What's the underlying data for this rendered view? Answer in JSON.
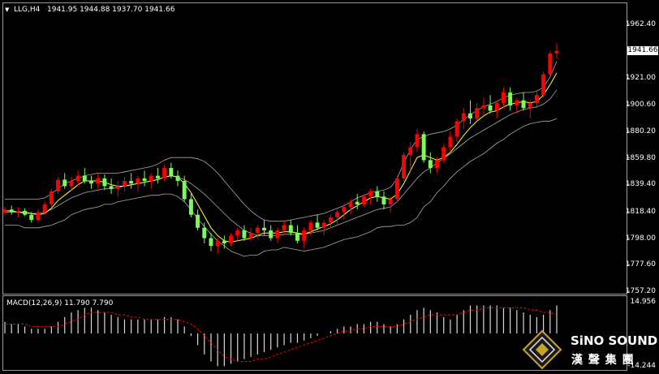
{
  "chart_header": {
    "dropdown_glyph": "▼",
    "symbol_tf": "LLG,H4",
    "ohlc": "1941.95 1944.88 1937.70 1941.66"
  },
  "price_axis": {
    "ticks": [
      "1962.40",
      "1941.66",
      "1921.00",
      "1900.60",
      "1880.20",
      "1859.80",
      "1839.40",
      "1818.40",
      "1798.00",
      "1777.60",
      "1757.20"
    ],
    "current_price": "1941.66"
  },
  "macd_panel": {
    "label": "MACD(12,26,9) 11.790 7.790",
    "max_label": "14.956",
    "min_label": "-14.244"
  },
  "watermark": {
    "brand_en": "SiNO SOUND",
    "brand_cn": "漢 聲 集 團",
    "logo_icon": "diamond-emblem-icon"
  },
  "colors": {
    "background": "#000000",
    "bull_candle": "#ff0000",
    "bear_candle": "#7cfc5a",
    "bollinger": "#a9a9a9",
    "moving_average": "#ffff33",
    "macd_histogram": "#d9d9d9",
    "macd_signal": "#ff0000",
    "text": "#ffffff"
  },
  "chart_data": {
    "type": "candlestick",
    "symbol": "LLG",
    "timeframe": "H4",
    "ylim": [
      1757.2,
      1965
    ],
    "candles": [
      [
        1818,
        1822,
        1815,
        1820
      ],
      [
        1820,
        1823,
        1816,
        1818
      ],
      [
        1818,
        1822,
        1814,
        1819
      ],
      [
        1819,
        1821,
        1815,
        1816
      ],
      [
        1816,
        1818,
        1810,
        1812
      ],
      [
        1812,
        1820,
        1810,
        1818
      ],
      [
        1818,
        1826,
        1816,
        1824
      ],
      [
        1824,
        1836,
        1822,
        1834
      ],
      [
        1834,
        1845,
        1832,
        1843
      ],
      [
        1843,
        1848,
        1836,
        1838
      ],
      [
        1838,
        1845,
        1834,
        1842
      ],
      [
        1842,
        1850,
        1838,
        1846
      ],
      [
        1846,
        1852,
        1840,
        1842
      ],
      [
        1842,
        1846,
        1836,
        1840
      ],
      [
        1840,
        1848,
        1836,
        1844
      ],
      [
        1844,
        1847,
        1835,
        1838
      ],
      [
        1838,
        1844,
        1832,
        1836
      ],
      [
        1836,
        1842,
        1830,
        1838
      ],
      [
        1838,
        1845,
        1834,
        1842
      ],
      [
        1842,
        1848,
        1836,
        1840
      ],
      [
        1840,
        1846,
        1834,
        1844
      ],
      [
        1844,
        1850,
        1838,
        1842
      ],
      [
        1842,
        1848,
        1836,
        1846
      ],
      [
        1846,
        1852,
        1840,
        1844
      ],
      [
        1844,
        1854,
        1842,
        1852
      ],
      [
        1852,
        1856,
        1844,
        1846
      ],
      [
        1846,
        1850,
        1838,
        1842
      ],
      [
        1842,
        1846,
        1826,
        1828
      ],
      [
        1828,
        1832,
        1814,
        1816
      ],
      [
        1816,
        1820,
        1804,
        1806
      ],
      [
        1806,
        1810,
        1794,
        1798
      ],
      [
        1798,
        1802,
        1788,
        1792
      ],
      [
        1792,
        1798,
        1786,
        1796
      ],
      [
        1796,
        1800,
        1790,
        1794
      ],
      [
        1794,
        1802,
        1792,
        1800
      ],
      [
        1800,
        1806,
        1796,
        1804
      ],
      [
        1804,
        1808,
        1796,
        1798
      ],
      [
        1798,
        1806,
        1796,
        1802
      ],
      [
        1802,
        1808,
        1798,
        1806
      ],
      [
        1806,
        1812,
        1800,
        1804
      ],
      [
        1804,
        1808,
        1796,
        1798
      ],
      [
        1798,
        1806,
        1794,
        1804
      ],
      [
        1804,
        1812,
        1800,
        1808
      ],
      [
        1808,
        1812,
        1800,
        1802
      ],
      [
        1802,
        1808,
        1794,
        1796
      ],
      [
        1796,
        1806,
        1790,
        1804
      ],
      [
        1804,
        1812,
        1800,
        1810
      ],
      [
        1810,
        1816,
        1804,
        1806
      ],
      [
        1806,
        1812,
        1800,
        1810
      ],
      [
        1810,
        1816,
        1806,
        1814
      ],
      [
        1814,
        1820,
        1808,
        1818
      ],
      [
        1818,
        1824,
        1812,
        1822
      ],
      [
        1822,
        1828,
        1816,
        1826
      ],
      [
        1826,
        1832,
        1820,
        1824
      ],
      [
        1824,
        1832,
        1822,
        1830
      ],
      [
        1830,
        1836,
        1824,
        1834
      ],
      [
        1834,
        1838,
        1826,
        1830
      ],
      [
        1830,
        1834,
        1820,
        1824
      ],
      [
        1824,
        1830,
        1818,
        1828
      ],
      [
        1828,
        1846,
        1826,
        1844
      ],
      [
        1844,
        1864,
        1842,
        1862
      ],
      [
        1862,
        1872,
        1850,
        1868
      ],
      [
        1868,
        1882,
        1864,
        1878
      ],
      [
        1878,
        1880,
        1856,
        1858
      ],
      [
        1858,
        1864,
        1848,
        1852
      ],
      [
        1852,
        1860,
        1848,
        1858
      ],
      [
        1858,
        1870,
        1856,
        1868
      ],
      [
        1868,
        1880,
        1864,
        1876
      ],
      [
        1876,
        1890,
        1872,
        1888
      ],
      [
        1888,
        1898,
        1882,
        1894
      ],
      [
        1894,
        1904,
        1886,
        1890
      ],
      [
        1890,
        1902,
        1888,
        1898
      ],
      [
        1898,
        1906,
        1892,
        1900
      ],
      [
        1900,
        1908,
        1894,
        1896
      ],
      [
        1896,
        1904,
        1890,
        1902
      ],
      [
        1902,
        1914,
        1898,
        1910
      ],
      [
        1910,
        1914,
        1896,
        1900
      ],
      [
        1900,
        1906,
        1894,
        1904
      ],
      [
        1904,
        1910,
        1896,
        1898
      ],
      [
        1898,
        1904,
        1890,
        1902
      ],
      [
        1902,
        1912,
        1898,
        1908
      ],
      [
        1908,
        1926,
        1906,
        1924
      ],
      [
        1924,
        1942,
        1922,
        1940
      ],
      [
        1940,
        1948,
        1936,
        1942
      ]
    ],
    "series": [
      {
        "name": "Bollinger Upper",
        "values": [
          1828,
          1828,
          1828,
          1828,
          1828,
          1828,
          1829,
          1832,
          1836,
          1840,
          1842,
          1844,
          1846,
          1847,
          1848,
          1848,
          1848,
          1848,
          1849,
          1850,
          1851,
          1852,
          1853,
          1855,
          1858,
          1860,
          1860,
          1860,
          1860,
          1859,
          1857,
          1853,
          1848,
          1842,
          1836,
          1830,
          1824,
          1819,
          1815,
          1812,
          1811,
          1811,
          1811,
          1812,
          1813,
          1814,
          1815,
          1816,
          1817,
          1819,
          1821,
          1823,
          1826,
          1829,
          1831,
          1833,
          1834,
          1835,
          1837,
          1844,
          1856,
          1866,
          1874,
          1876,
          1878,
          1879,
          1880,
          1882,
          1885,
          1889,
          1893,
          1896,
          1899,
          1901,
          1903,
          1906,
          1908,
          1909,
          1910,
          1910,
          1911,
          1914,
          1922,
          1934
        ]
      },
      {
        "name": "Bollinger Middle",
        "values": [
          1818,
          1818,
          1818,
          1817,
          1817,
          1817,
          1818,
          1820,
          1823,
          1826,
          1829,
          1831,
          1833,
          1834,
          1835,
          1836,
          1836,
          1837,
          1838,
          1839,
          1840,
          1841,
          1842,
          1843,
          1845,
          1846,
          1845,
          1843,
          1840,
          1836,
          1832,
          1827,
          1822,
          1817,
          1812,
          1808,
          1804,
          1802,
          1800,
          1800,
          1800,
          1800,
          1801,
          1801,
          1801,
          1801,
          1802,
          1803,
          1804,
          1806,
          1808,
          1810,
          1812,
          1814,
          1816,
          1818,
          1820,
          1821,
          1822,
          1826,
          1832,
          1838,
          1844,
          1849,
          1852,
          1856,
          1859,
          1863,
          1867,
          1871,
          1875,
          1878,
          1881,
          1884,
          1887,
          1890,
          1893,
          1895,
          1897,
          1898,
          1899,
          1901,
          1905,
          1912
        ]
      },
      {
        "name": "Bollinger Lower",
        "values": [
          1808,
          1808,
          1808,
          1806,
          1806,
          1806,
          1807,
          1808,
          1810,
          1812,
          1816,
          1818,
          1820,
          1821,
          1822,
          1824,
          1824,
          1826,
          1827,
          1828,
          1829,
          1830,
          1831,
          1831,
          1832,
          1832,
          1830,
          1826,
          1820,
          1813,
          1807,
          1801,
          1796,
          1792,
          1788,
          1786,
          1784,
          1785,
          1785,
          1788,
          1789,
          1789,
          1791,
          1790,
          1789,
          1788,
          1789,
          1790,
          1791,
          1793,
          1795,
          1797,
          1798,
          1799,
          1801,
          1803,
          1806,
          1807,
          1807,
          1808,
          1808,
          1810,
          1814,
          1822,
          1826,
          1833,
          1838,
          1844,
          1849,
          1853,
          1857,
          1860,
          1863,
          1867,
          1871,
          1874,
          1878,
          1881,
          1884,
          1886,
          1887,
          1888,
          1888,
          1890
        ]
      },
      {
        "name": "Moving Average",
        "values": [
          1819,
          1819,
          1818,
          1818,
          1817,
          1816,
          1817,
          1821,
          1827,
          1831,
          1835,
          1839,
          1842,
          1842,
          1842,
          1841,
          1839,
          1838,
          1838,
          1839,
          1840,
          1841,
          1842,
          1843,
          1845,
          1846,
          1845,
          1840,
          1833,
          1824,
          1815,
          1806,
          1800,
          1796,
          1795,
          1796,
          1797,
          1798,
          1800,
          1802,
          1802,
          1802,
          1803,
          1803,
          1802,
          1801,
          1803,
          1805,
          1807,
          1809,
          1812,
          1816,
          1820,
          1823,
          1826,
          1829,
          1830,
          1829,
          1828,
          1832,
          1840,
          1850,
          1860,
          1862,
          1860,
          1858,
          1860,
          1864,
          1870,
          1877,
          1883,
          1888,
          1892,
          1895,
          1896,
          1899,
          1901,
          1902,
          1903,
          1902,
          1903,
          1908,
          1916,
          1925
        ]
      }
    ],
    "macd": {
      "histogram": [
        5,
        4,
        4,
        3,
        2,
        2,
        2,
        3,
        5,
        7,
        9,
        10,
        11,
        11,
        10,
        9,
        8,
        7,
        6,
        6,
        6,
        6,
        6,
        6,
        7,
        7,
        6,
        3,
        -1,
        -5,
        -9,
        -12,
        -14,
        -14,
        -13,
        -12,
        -11,
        -10,
        -9,
        -8,
        -7,
        -6,
        -5,
        -4,
        -4,
        -3,
        -2,
        -1,
        0,
        1,
        2,
        3,
        3,
        4,
        4,
        5,
        5,
        4,
        3,
        4,
        6,
        8,
        10,
        11,
        10,
        9,
        7,
        6,
        8,
        10,
        12,
        12,
        12,
        12,
        12,
        11,
        11,
        10,
        9,
        8,
        7,
        8,
        10,
        12
      ],
      "signal": [
        4,
        4,
        4,
        4,
        3,
        3,
        3,
        3,
        3,
        4,
        5,
        6,
        8,
        9,
        9,
        9,
        9,
        8,
        8,
        7,
        7,
        6,
        6,
        6,
        6,
        6,
        6,
        5,
        4,
        2,
        -1,
        -4,
        -7,
        -10,
        -11,
        -12,
        -12,
        -12,
        -11,
        -11,
        -10,
        -9,
        -8,
        -7,
        -6,
        -5,
        -4,
        -3,
        -2,
        -1,
        0,
        1,
        1,
        2,
        2,
        3,
        3,
        3,
        3,
        3,
        4,
        5,
        6,
        7,
        8,
        8,
        8,
        8,
        8,
        9,
        10,
        10,
        11,
        11,
        11,
        11,
        11,
        11,
        11,
        10,
        10,
        9,
        9,
        8
      ]
    }
  }
}
